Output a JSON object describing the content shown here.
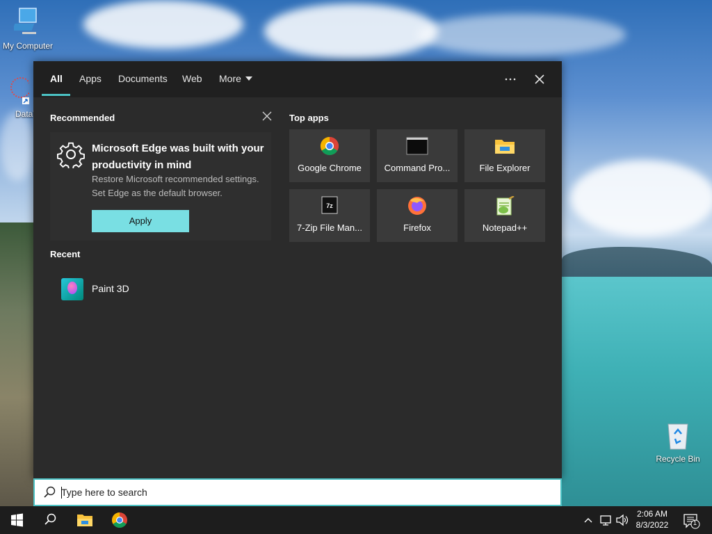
{
  "desktop": {
    "icons": [
      {
        "label": "My Computer"
      },
      {
        "label": "DataWag"
      },
      {
        "label": "Recycle Bin"
      }
    ]
  },
  "flyout": {
    "tabs": [
      {
        "label": "All",
        "active": true
      },
      {
        "label": "Apps"
      },
      {
        "label": "Documents"
      },
      {
        "label": "Web"
      },
      {
        "label": "More"
      }
    ],
    "options_icon": "ellipsis-icon",
    "close_icon": "close-icon",
    "recommended": {
      "title": "Recommended",
      "heading": "Microsoft Edge was built with your productivity in mind",
      "description": "Restore Microsoft recommended settings. Set Edge as the default browser.",
      "apply_label": "Apply",
      "dismiss_icon": "close-icon"
    },
    "recent": {
      "title": "Recent",
      "items": [
        {
          "label": "Paint 3D",
          "icon": "paint3d-icon"
        }
      ]
    },
    "top_apps": {
      "title": "Top apps",
      "items": [
        {
          "label": "Google Chrome",
          "icon": "chrome-icon"
        },
        {
          "label": "Command Pro...",
          "icon": "command-prompt-icon"
        },
        {
          "label": "File Explorer",
          "icon": "file-explorer-icon"
        },
        {
          "label": "7-Zip File Man...",
          "icon": "7zip-icon"
        },
        {
          "label": "Firefox",
          "icon": "firefox-icon"
        },
        {
          "label": "Notepad++",
          "icon": "notepadpp-icon"
        }
      ]
    }
  },
  "search": {
    "placeholder": "Type here to search"
  },
  "taskbar": {
    "pinned": [
      "start-icon",
      "search-icon",
      "file-explorer-icon",
      "chrome-icon"
    ],
    "tray_icons": [
      "chevron-up-icon",
      "network-icon",
      "volume-icon"
    ],
    "time": "2:06 AM",
    "date": "8/3/2022",
    "notification_count": "1"
  },
  "colors": {
    "accent": "#4cc2c4",
    "apply_button": "#79dfe3",
    "flyout_bg": "#2b2b2b",
    "header_bg": "#202020",
    "tile_bg": "#3a3a3a",
    "taskbar_bg": "#1d1d1d"
  }
}
